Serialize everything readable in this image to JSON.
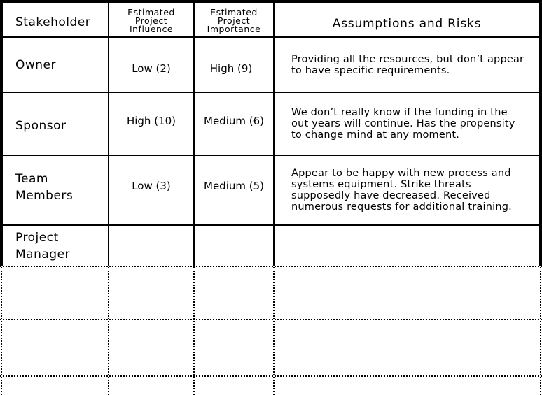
{
  "table": {
    "headers": {
      "stakeholder": "Stakeholder",
      "influence": "Estimated Project Influence",
      "importance": "Estimated Project Importance",
      "assumptions": "Assumptions and Risks"
    },
    "rows": [
      {
        "stakeholder": "Owner",
        "influence": "Low (2)",
        "importance": "High (9)",
        "assumptions": "Providing all the resources, but don’t appear to have specific requirements."
      },
      {
        "stakeholder": "Sponsor",
        "influence": "High (10)",
        "importance": "Medium (6)",
        "assumptions": "We don’t really know if the funding in the out years will continue. Has the propensity to change mind at any moment."
      },
      {
        "stakeholder": "Team Members",
        "influence": "Low (3)",
        "importance": "Medium (5)",
        "assumptions": "Appear to be happy with new process and systems equipment. Strike threats supposedly have decreased. Received numerous requests for additional training."
      },
      {
        "stakeholder": "Project Manager",
        "influence": "",
        "importance": "",
        "assumptions": ""
      }
    ]
  }
}
